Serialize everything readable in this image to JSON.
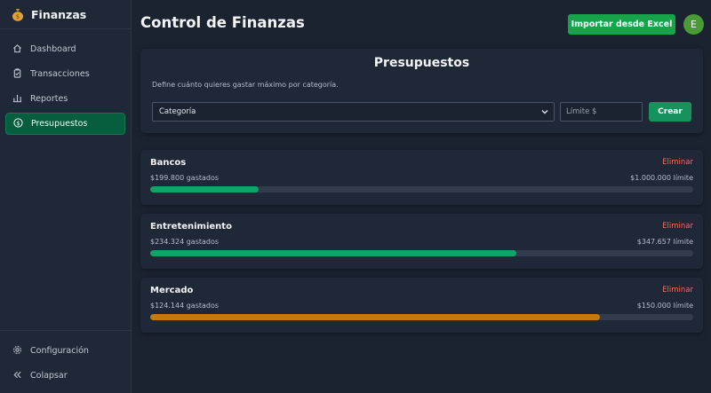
{
  "app": {
    "name": "Finanzas",
    "logo_icon": "money-bag-icon"
  },
  "sidebar": {
    "items": [
      {
        "label": "Dashboard",
        "icon": "home-icon",
        "active": false
      },
      {
        "label": "Transacciones",
        "icon": "clipboard-icon",
        "active": false
      },
      {
        "label": "Reportes",
        "icon": "bar-chart-icon",
        "active": false
      },
      {
        "label": "Presupuestos",
        "icon": "dollar-circle-icon",
        "active": true
      }
    ],
    "bottom": [
      {
        "label": "Configuración",
        "icon": "gear-icon"
      },
      {
        "label": "Colapsar",
        "icon": "double-chevron-left-icon"
      }
    ]
  },
  "header": {
    "title": "Control de Finanzas",
    "import_label": "Importar desde Excel",
    "avatar_initial": "E"
  },
  "form": {
    "title": "Presupuestos",
    "description": "Define cuánto quieres gastar máximo por categoría.",
    "category_placeholder": "Categoría",
    "limit_placeholder": "Límite $",
    "create_label": "Crear"
  },
  "budgets": [
    {
      "name": "Bancos",
      "delete_label": "Eliminar",
      "spent": "$199.800 gastados",
      "limit": "$1.000.000 límite",
      "progress": 0.1998,
      "color": "#11a36a"
    },
    {
      "name": "Entretenimiento",
      "delete_label": "Eliminar",
      "spent": "$234.324 gastados",
      "limit": "$347.657 límite",
      "progress": 0.674,
      "color": "#11a36a"
    },
    {
      "name": "Mercado",
      "delete_label": "Eliminar",
      "spent": "$124.144 gastados",
      "limit": "$150.000 límite",
      "progress": 0.8276,
      "color": "#c47a12"
    }
  ],
  "colors": {
    "accent": "#17a34a",
    "danger": "#f26e6e",
    "warning": "#c47a12"
  }
}
